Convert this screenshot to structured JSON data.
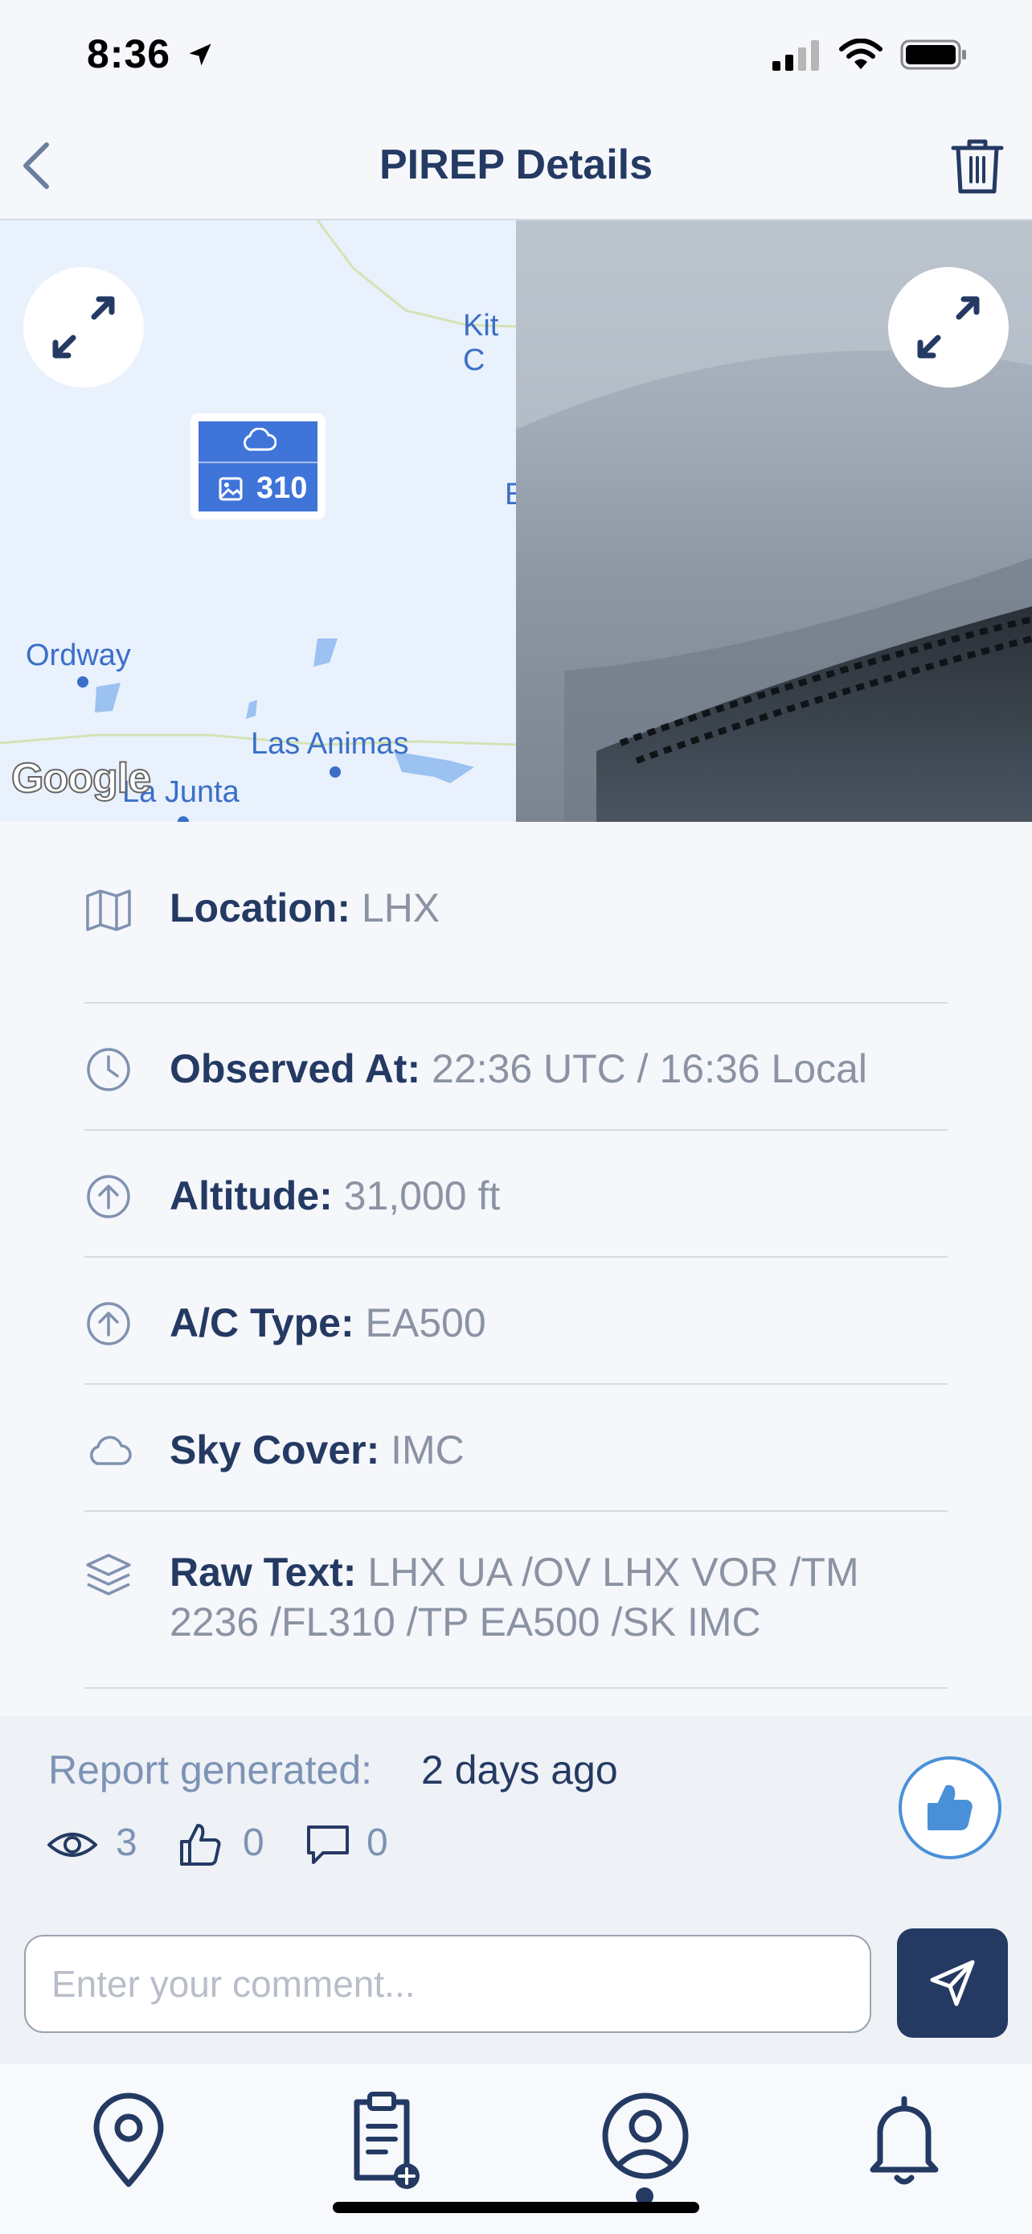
{
  "status_bar": {
    "time": "8:36"
  },
  "nav": {
    "title": "PIREP Details"
  },
  "map": {
    "labels": {
      "kit": "Kit C",
      "edge": "E",
      "ordway": "Ordway",
      "las_animas": "Las Animas",
      "la_junta": "La Junta"
    },
    "marker_altitude": "310",
    "attribution": "Google"
  },
  "details": {
    "location": {
      "label": "Location:",
      "value": "LHX",
      "icon": "map-icon"
    },
    "observed_at": {
      "label": "Observed At:",
      "value": "22:36 UTC / 16:36 Local",
      "icon": "clock-icon"
    },
    "altitude": {
      "label": "Altitude:",
      "value": "31,000 ft",
      "icon": "arrow-up-circle-icon"
    },
    "ac_type": {
      "label": "A/C Type:",
      "value": "EA500",
      "icon": "arrow-up-circle-icon"
    },
    "sky_cover": {
      "label": "Sky Cover:",
      "value": "IMC",
      "icon": "cloud-icon"
    },
    "raw_text": {
      "label": "Raw Text:",
      "value_line1": "LHX UA /OV LHX VOR /TM",
      "value_line2": "2236 /FL310 /TP EA500 /SK IMC",
      "icon": "layers-icon"
    }
  },
  "footer": {
    "report_label": "Report generated:",
    "report_value": "2 days ago",
    "views": "3",
    "likes": "0",
    "comments": "0",
    "comment_placeholder": "Enter your comment..."
  },
  "tabs": [
    {
      "icon": "map-pin-icon"
    },
    {
      "icon": "clipboard-add-icon"
    },
    {
      "icon": "user-profile-icon",
      "active": true
    },
    {
      "icon": "bell-icon"
    }
  ],
  "colors": {
    "primary": "#243a63",
    "accent": "#4a90d9",
    "marker": "#3f74d9",
    "muted": "#7d93b5"
  }
}
